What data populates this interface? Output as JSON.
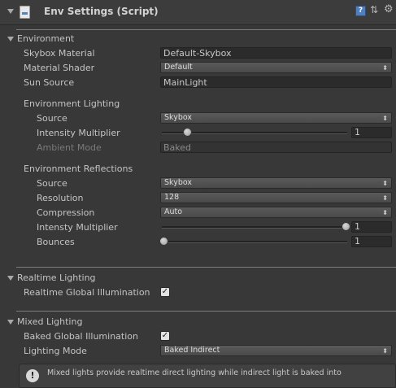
{
  "header": {
    "title": "Env Settings (Script)",
    "help_glyph": "?"
  },
  "environment": {
    "title": "Environment",
    "skybox_material": {
      "label": "Skybox Material",
      "value": "Default-Skybox"
    },
    "material_shader": {
      "label": "Material Shader",
      "value": "Default"
    },
    "sun_source": {
      "label": "Sun Source",
      "value": "MainLight"
    },
    "lighting": {
      "title": "Environment Lighting",
      "source": {
        "label": "Source",
        "value": "Skybox"
      },
      "intensity": {
        "label": "Intensity Multiplier",
        "value": "1",
        "slider_fraction": 0.13
      },
      "ambient_mode": {
        "label": "Ambient Mode",
        "value": "Baked"
      }
    },
    "reflections": {
      "title": "Environment Reflections",
      "source": {
        "label": "Source",
        "value": "Skybox"
      },
      "resolution": {
        "label": "Resolution",
        "value": "128"
      },
      "compression": {
        "label": "Compression",
        "value": "Auto"
      },
      "intensity": {
        "label": "Intensty Multiplier",
        "value": "1",
        "slider_fraction": 1.0
      },
      "bounces": {
        "label": "Bounces",
        "value": "1",
        "slider_fraction": 0.0
      }
    }
  },
  "realtime": {
    "title": "Realtime Lighting",
    "global_illumination": {
      "label": "Realtime Global Illumination",
      "checked": true
    }
  },
  "mixed": {
    "title": "Mixed Lighting",
    "baked_gi": {
      "label": "Baked Global Illumination",
      "checked": true
    },
    "lighting_mode": {
      "label": "Lighting Mode",
      "value": "Baked Indirect"
    },
    "help_text": "Mixed lights provide realtime direct lighting while indirect light is baked into"
  },
  "glyphs": {
    "check": "✓",
    "dropdown_arrow": "⬍",
    "info": "!"
  },
  "colors": {
    "panel_bg": "#383838",
    "field_bg": "#2b2b2b",
    "help_icon": "#4f7fbf"
  }
}
